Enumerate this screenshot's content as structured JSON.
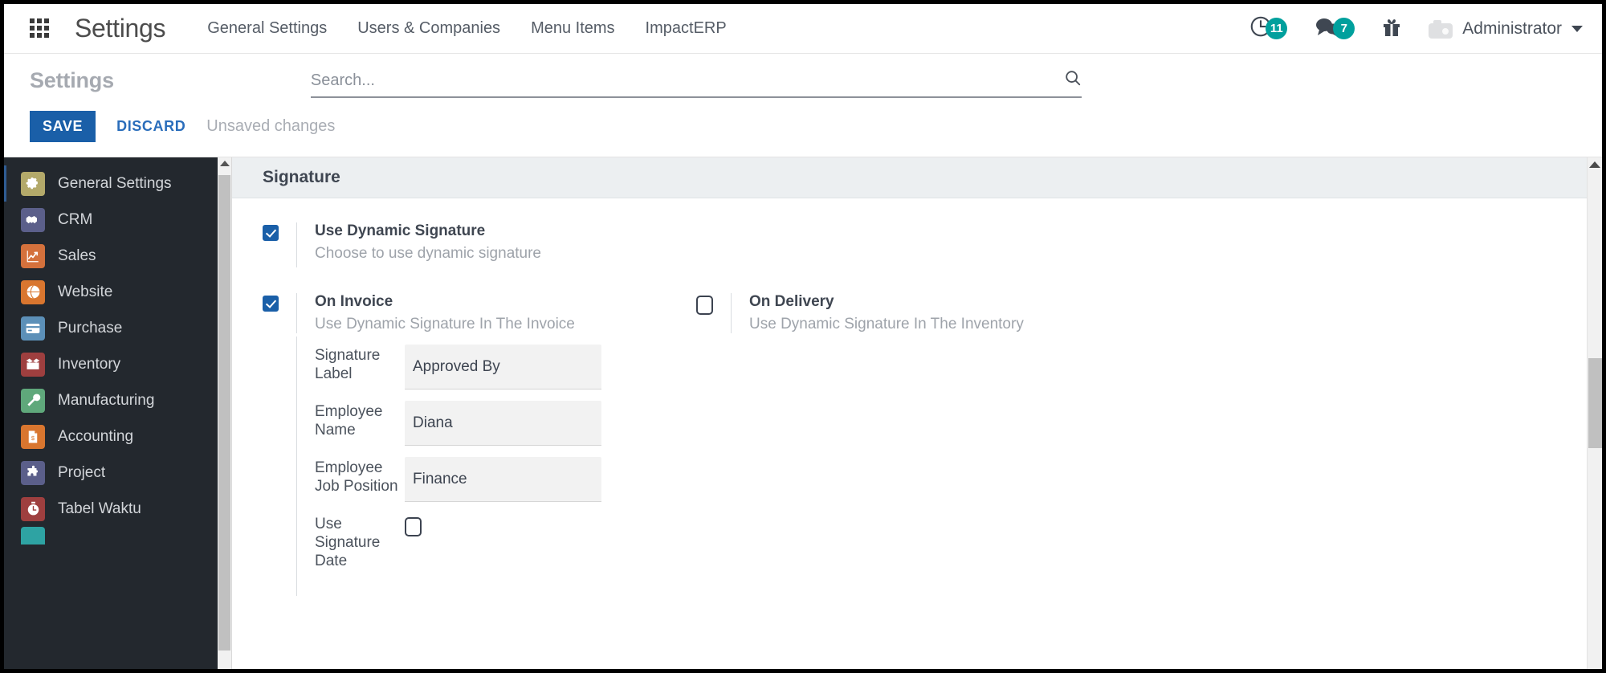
{
  "navbar": {
    "brand": "Settings",
    "apps_icon": "apps-grid-icon",
    "links": [
      {
        "label": "General Settings"
      },
      {
        "label": "Users & Companies"
      },
      {
        "label": "Menu Items"
      },
      {
        "label": "ImpactERP"
      }
    ],
    "activities": {
      "icon": "clock-icon",
      "glyph": "◴",
      "count": "11"
    },
    "messages": {
      "icon": "chat-bubbles-icon",
      "glyph": "💬",
      "count": "7"
    },
    "gift": {
      "icon": "gift-icon",
      "glyph": "🎁"
    },
    "user": {
      "name": "Administrator",
      "avatar_icon": "camera-avatar-icon",
      "caret_icon": "chevron-down-icon"
    },
    "badge_color": "#00A09D"
  },
  "control_panel": {
    "page_title": "Settings",
    "search": {
      "placeholder": "Search...",
      "value": "",
      "icon": "search-icon"
    },
    "save_label": "SAVE",
    "discard_label": "DISCARD",
    "status_text": "Unsaved changes",
    "save_color": "#1a5fa8"
  },
  "sidebar": {
    "items": [
      {
        "label": "General Settings",
        "icon": "gear-icon",
        "glyph": "⚙",
        "color": "#b3a96a",
        "active": true
      },
      {
        "label": "CRM",
        "icon": "handshake-icon",
        "glyph": "🤝",
        "color": "#5b5f8a",
        "active": false
      },
      {
        "label": "Sales",
        "icon": "line-chart-icon",
        "glyph": "📈",
        "color": "#d4713c",
        "active": false
      },
      {
        "label": "Website",
        "icon": "globe-icon",
        "glyph": "🌐",
        "color": "#d9762f",
        "active": false
      },
      {
        "label": "Purchase",
        "icon": "credit-card-icon",
        "glyph": "💳",
        "color": "#5c90b8",
        "active": false
      },
      {
        "label": "Inventory",
        "icon": "open-box-icon",
        "glyph": "📦",
        "color": "#9e3f3f",
        "active": false
      },
      {
        "label": "Manufacturing",
        "icon": "wrench-icon",
        "glyph": "🔧",
        "color": "#5fa87b",
        "active": false
      },
      {
        "label": "Accounting",
        "icon": "invoice-icon",
        "glyph": "📄",
        "color": "#d9762f",
        "active": false
      },
      {
        "label": "Project",
        "icon": "puzzle-icon",
        "glyph": "🧩",
        "color": "#5b5f8a",
        "active": false
      },
      {
        "label": "Tabel Waktu",
        "icon": "stopwatch-icon",
        "glyph": "⏱",
        "color": "#9e3f3f",
        "active": false
      },
      {
        "label": "",
        "icon": "partial-item-icon",
        "glyph": "",
        "color": "#2ea3a3",
        "active": false
      }
    ]
  },
  "main": {
    "section_title": "Signature",
    "use_dynamic": {
      "title": "Use Dynamic Signature",
      "subtitle": "Choose to use dynamic signature",
      "checked": true
    },
    "on_invoice": {
      "title": "On Invoice",
      "subtitle": "Use Dynamic Signature In The Invoice",
      "checked": true
    },
    "on_delivery": {
      "title": "On Delivery",
      "subtitle": "Use Dynamic Signature In The Inventory",
      "checked": false
    },
    "fields": {
      "signature_label": {
        "label": "Signature Label",
        "value": "Approved By"
      },
      "employee_name": {
        "label": "Employee Name",
        "value": "Diana"
      },
      "employee_job_position": {
        "label": "Employee Job Position",
        "value": "Finance"
      },
      "use_signature_date": {
        "label": "Use Signature Date",
        "checked": false
      }
    }
  }
}
